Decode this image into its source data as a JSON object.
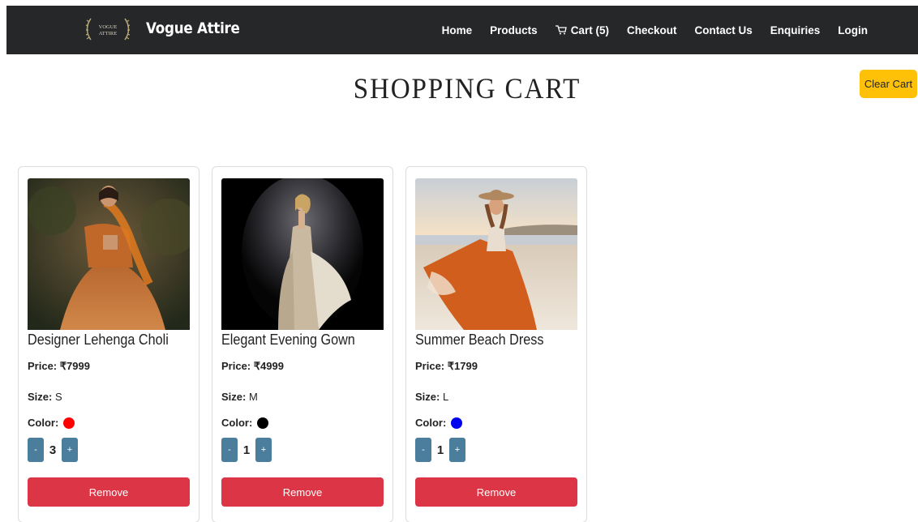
{
  "navbar": {
    "logo_text": "VOGUE ATTIRE",
    "brand": "Vogue Attire",
    "links": {
      "home": "Home",
      "products": "Products",
      "cart": "Cart (5)",
      "checkout": "Checkout",
      "contact": "Contact Us",
      "enquiries": "Enquiries",
      "login": "Login"
    }
  },
  "page": {
    "title": "SHOPPING CART",
    "clear_cart": "Clear Cart"
  },
  "labels": {
    "price": "Price:",
    "size": "Size:",
    "color": "Color:",
    "minus": "-",
    "plus": "+",
    "remove": "Remove"
  },
  "cart": {
    "items": [
      {
        "name": "Designer Lehenga Choli",
        "price": "₹7999",
        "size": "S",
        "color": "#ff0000",
        "color_name": "red",
        "qty": "3",
        "image": "lehenga-photo"
      },
      {
        "name": "Elegant Evening Gown",
        "price": "₹4999",
        "size": "M",
        "color": "#000000",
        "color_name": "black",
        "qty": "1",
        "image": "gown-photo"
      },
      {
        "name": "Summer Beach Dress",
        "price": "₹1799",
        "size": "L",
        "color": "#0000ee",
        "color_name": "blue",
        "qty": "1",
        "image": "beach-dress-photo"
      }
    ]
  },
  "colors": {
    "navbar_bg": "#262729",
    "clear_cart_bg": "#ffc107",
    "qty_btn_bg": "#4a7e9c",
    "remove_bg": "#dc3545"
  }
}
